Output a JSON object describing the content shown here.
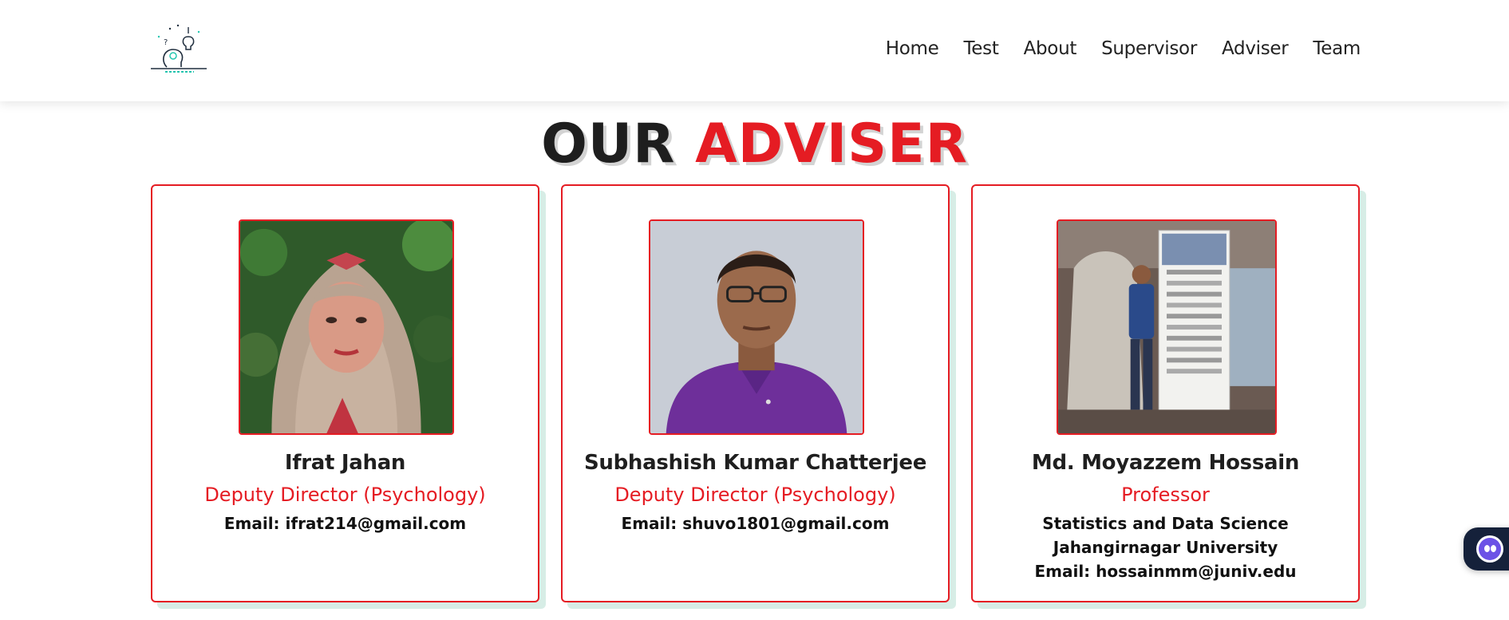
{
  "nav": {
    "items": [
      {
        "label": "Home"
      },
      {
        "label": "Test"
      },
      {
        "label": "About"
      },
      {
        "label": "Supervisor"
      },
      {
        "label": "Adviser"
      },
      {
        "label": "Team"
      }
    ]
  },
  "section": {
    "title_part1": "OUR",
    "title_part2": "ADVISER"
  },
  "advisers": [
    {
      "name": "Ifrat Jahan",
      "role": "Deputy Director (Psychology)",
      "lines": [
        "Email: ifrat214@gmail.com"
      ]
    },
    {
      "name": "Subhashish Kumar Chatterjee",
      "role": "Deputy Director (Psychology)",
      "lines": [
        "Email: shuvo1801@gmail.com"
      ]
    },
    {
      "name": "Md. Moyazzem Hossain",
      "role": "Professor",
      "lines": [
        "Statistics and Data Science",
        "Jahangirnagar University",
        "Email: hossainmm@juniv.edu"
      ]
    }
  ],
  "colors": {
    "accent": "#e51c23",
    "card_shadow": "#d7ede6",
    "chat_bg": "#15213a",
    "chat_icon": "#6c52e6"
  }
}
